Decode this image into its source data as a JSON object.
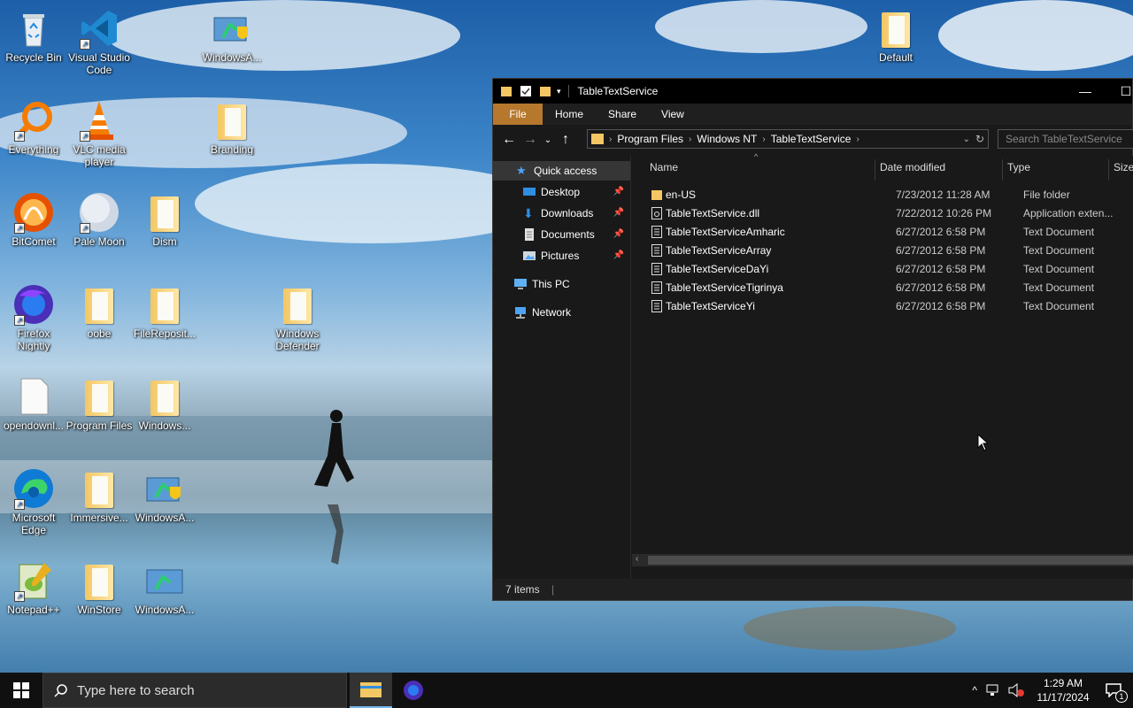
{
  "desktop": {
    "icons": [
      {
        "label": "Recycle Bin"
      },
      {
        "label": "Visual Studio Code"
      },
      {
        "label": "WindowsA..."
      },
      {
        "label": "Default"
      },
      {
        "label": "Everything"
      },
      {
        "label": "VLC media player"
      },
      {
        "label": "Branding"
      },
      {
        "label": "BitComet"
      },
      {
        "label": "Pale Moon"
      },
      {
        "label": "Dism"
      },
      {
        "label": "Firefox Nightly"
      },
      {
        "label": "oobe"
      },
      {
        "label": "FileReposit..."
      },
      {
        "label": "Windows Defender"
      },
      {
        "label": "opendownl..."
      },
      {
        "label": "Program Files"
      },
      {
        "label": "Windows..."
      },
      {
        "label": "Microsoft Edge"
      },
      {
        "label": "Immersive..."
      },
      {
        "label": "WindowsA..."
      },
      {
        "label": "Notepad++"
      },
      {
        "label": "WinStore"
      },
      {
        "label": "WindowsA..."
      }
    ]
  },
  "explorer": {
    "title": "TableTextService",
    "ribbon_tabs": [
      "File",
      "Home",
      "Share",
      "View"
    ],
    "breadcrumb": [
      "Program Files",
      "Windows NT",
      "TableTextService"
    ],
    "search_placeholder": "Search TableTextService",
    "nav": {
      "quick_access": "Quick access",
      "desktop": "Desktop",
      "downloads": "Downloads",
      "documents": "Documents",
      "pictures": "Pictures",
      "this_pc": "This PC",
      "network": "Network"
    },
    "columns": {
      "name": "Name",
      "date": "Date modified",
      "type": "Type",
      "size": "Size"
    },
    "files": [
      {
        "name": "en-US",
        "date": "7/23/2012 11:28 AM",
        "type": "File folder",
        "icon": "folder-icon"
      },
      {
        "name": "TableTextService.dll",
        "date": "7/22/2012 10:26 PM",
        "type": "Application exten...",
        "icon": "dll-file-icon"
      },
      {
        "name": "TableTextServiceAmharic",
        "date": "6/27/2012 6:58 PM",
        "type": "Text Document",
        "icon": "text-file-icon"
      },
      {
        "name": "TableTextServiceArray",
        "date": "6/27/2012 6:58 PM",
        "type": "Text Document",
        "icon": "text-file-icon"
      },
      {
        "name": "TableTextServiceDaYi",
        "date": "6/27/2012 6:58 PM",
        "type": "Text Document",
        "icon": "text-file-icon"
      },
      {
        "name": "TableTextServiceTigrinya",
        "date": "6/27/2012 6:58 PM",
        "type": "Text Document",
        "icon": "text-file-icon"
      },
      {
        "name": "TableTextServiceYi",
        "date": "6/27/2012 6:58 PM",
        "type": "Text Document",
        "icon": "text-file-icon"
      }
    ],
    "status": "7 items"
  },
  "taskbar": {
    "search_placeholder": "Type here to search",
    "time": "1:29 AM",
    "date": "11/17/2024",
    "notification_count": "1"
  }
}
